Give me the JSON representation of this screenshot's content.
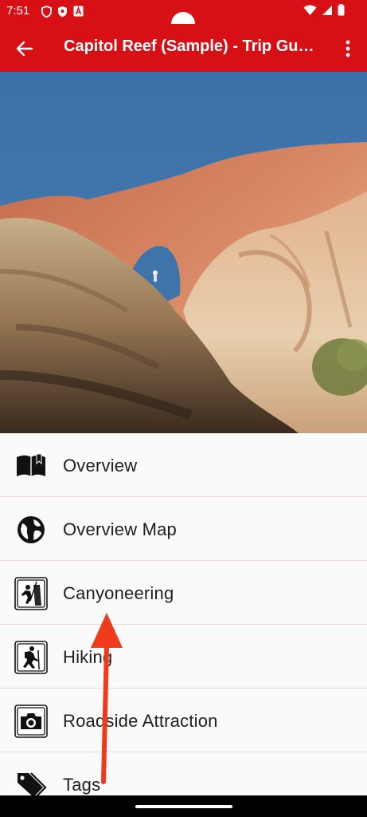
{
  "status_bar": {
    "time": "7:51",
    "icons_left": [
      "shield-icon",
      "shield-badge-icon",
      "font-icon"
    ],
    "icons_right": [
      "wifi-icon",
      "signal-icon",
      "battery-icon"
    ]
  },
  "app_bar": {
    "title": "Capitol Reef (Sample) - Trip Guide",
    "background": "#d71016"
  },
  "hero": {
    "subject": "sandstone-arch-photo"
  },
  "menu": {
    "items": [
      {
        "label": "Overview",
        "icon": "book-icon"
      },
      {
        "label": "Overview Map",
        "icon": "globe-icon"
      },
      {
        "label": "Canyoneering",
        "icon": "rappel-icon"
      },
      {
        "label": "Hiking",
        "icon": "hiker-icon"
      },
      {
        "label": "Roadside Attraction",
        "icon": "camera-icon"
      },
      {
        "label": "Tags",
        "icon": "tag-icon"
      }
    ]
  },
  "annotation": {
    "type": "arrow",
    "color": "#f03a1c",
    "direction": "up"
  }
}
